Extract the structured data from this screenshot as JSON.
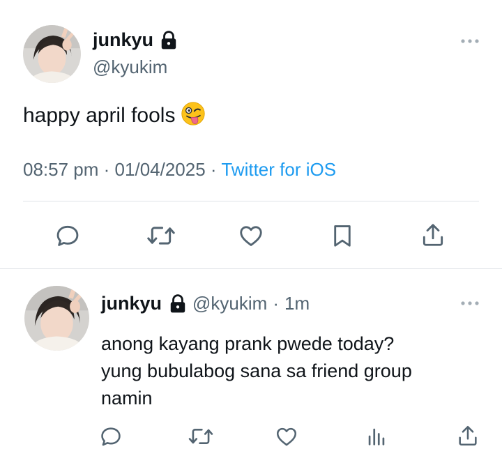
{
  "main_tweet": {
    "display_name": "junkyu",
    "handle": "@kyukim",
    "text": "happy april fools",
    "emoji": "winking-face-with-tongue",
    "time": "08:57 pm",
    "separator": "·",
    "date": "01/04/2025",
    "source": "Twitter for iOS"
  },
  "reply": {
    "display_name": "junkyu",
    "handle": "@kyukim",
    "separator": "·",
    "time_ago": "1m",
    "line1": "anong kayang prank pwede today?",
    "line2": "yung bubulabog sana sa friend group",
    "line3": "namin"
  },
  "icons": {
    "main_actions": [
      "reply-icon",
      "retweet-icon",
      "like-icon",
      "bookmark-icon",
      "share-icon"
    ],
    "reply_actions": [
      "reply-icon",
      "retweet-icon",
      "like-icon",
      "views-icon",
      "share-icon"
    ]
  },
  "colors": {
    "text": "#0f1419",
    "secondary": "#536471",
    "link": "#1d9bf0",
    "divider": "#dfe3e7"
  }
}
